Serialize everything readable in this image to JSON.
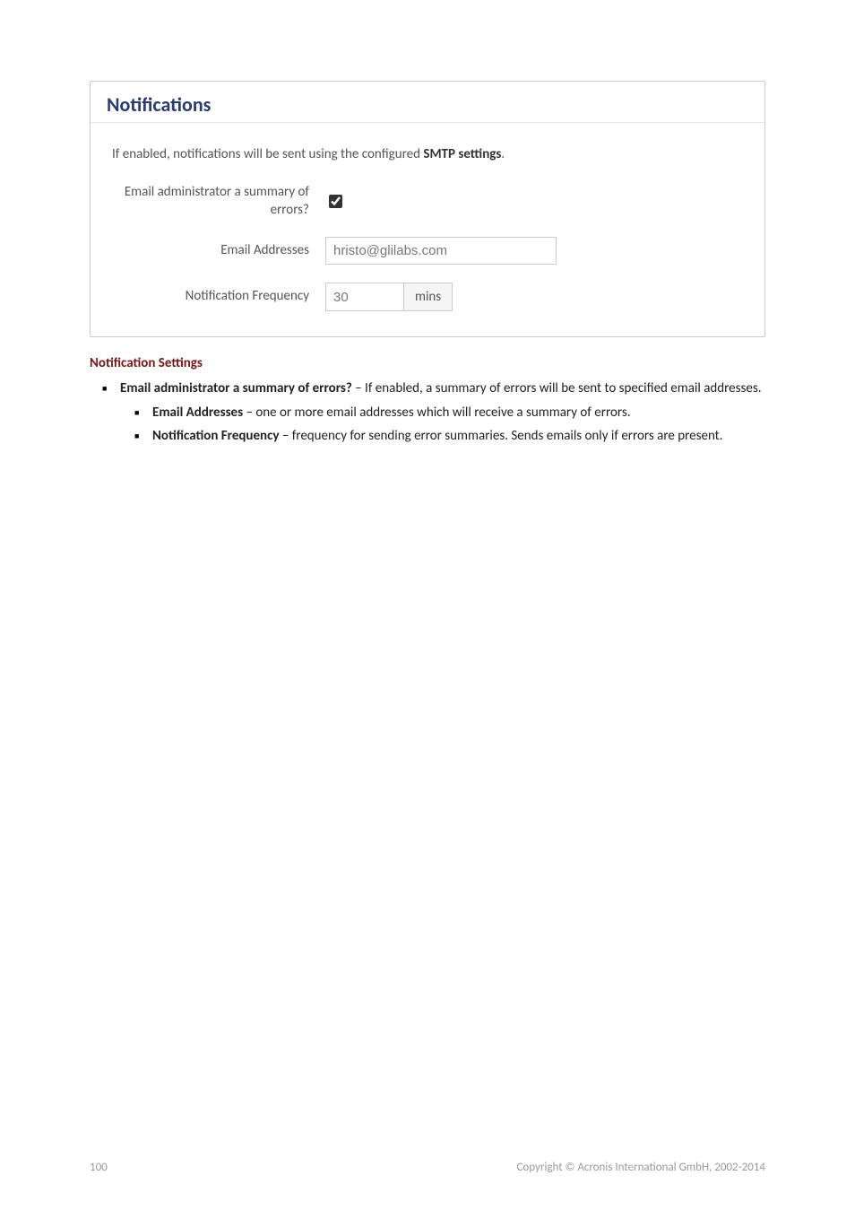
{
  "panel": {
    "title": "Notifications",
    "info_prefix": "If enabled, notifications will be sent using the configured ",
    "smtp_text": "SMTP settings",
    "info_suffix": ".",
    "fields": {
      "email_summary_label": "Email administrator a summary of errors?",
      "email_summary_checked": true,
      "email_addresses_label": "Email Addresses",
      "email_addresses_value": "hristo@glilabs.com",
      "notification_frequency_label": "Notification Frequency",
      "notification_frequency_value": "30",
      "notification_frequency_unit": "mins"
    }
  },
  "doc": {
    "section_title": "Notification Settings",
    "item1_bold": "Email administrator a summary of errors?",
    "item1_rest": " – If enabled, a summary of errors will be sent to specified email addresses.",
    "item1a_bold": "Email Addresses",
    "item1a_rest": " – one or more email addresses which will receive a summary of errors.",
    "item1b_bold": "Notification Frequency",
    "item1b_rest": " – frequency for sending error summaries. Sends emails only if errors are present."
  },
  "footer": {
    "page_number": "100",
    "copyright": "Copyright © Acronis International GmbH, 2002-2014"
  }
}
